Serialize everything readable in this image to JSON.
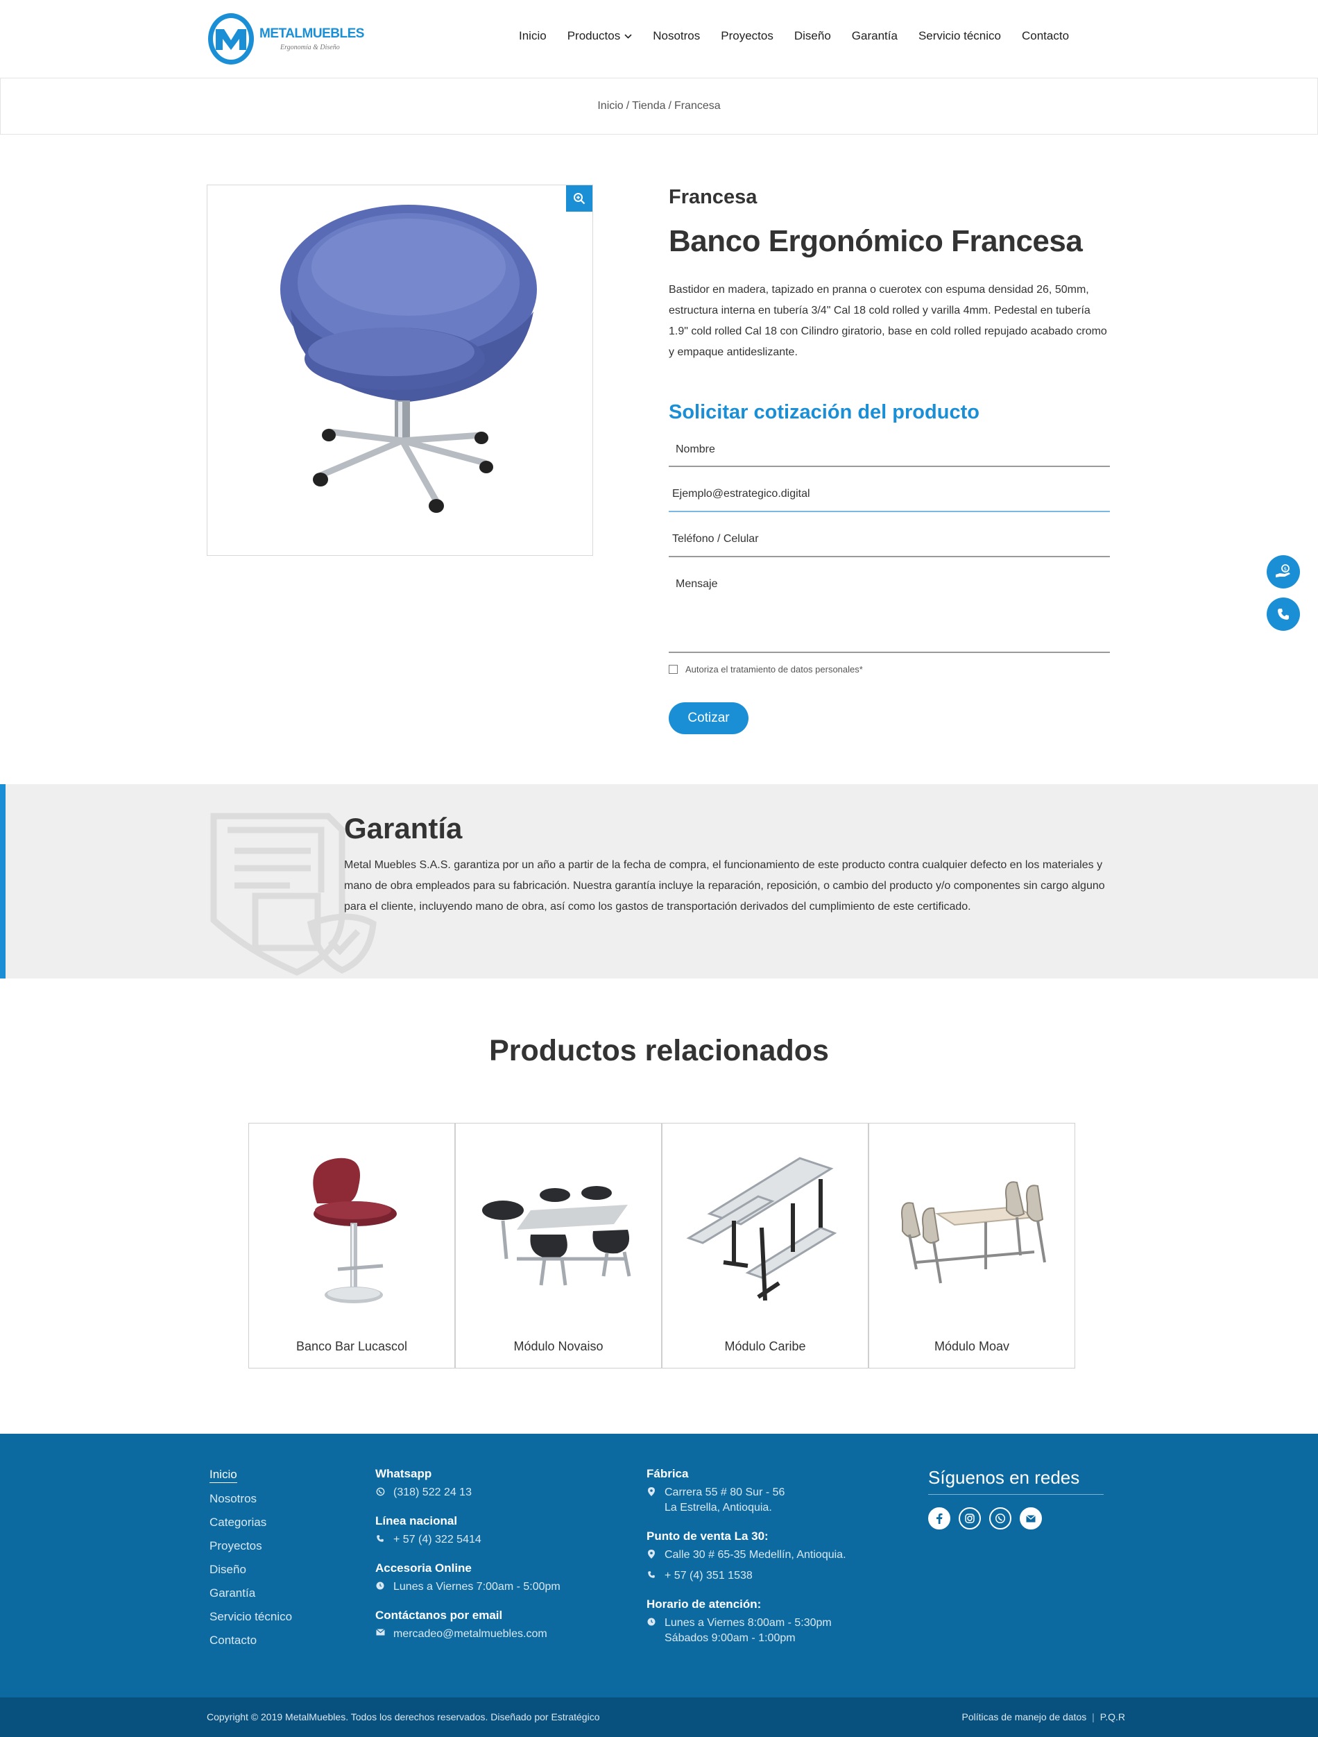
{
  "header": {
    "logo": {
      "name": "METALMUEBLES",
      "tagline": "Ergonomía & Diseño"
    },
    "nav": [
      "Inicio",
      "Productos",
      "Nosotros",
      "Proyectos",
      "Diseño",
      "Garantía",
      "Servicio técnico",
      "Contacto"
    ]
  },
  "breadcrumb": {
    "home": "Inicio",
    "sep": "/",
    "shop": "Tienda",
    "current": "Francesa"
  },
  "product": {
    "category": "Francesa",
    "title": "Banco Ergonómico Francesa",
    "description": "Bastidor en madera, tapizado en pranna o cuerotex con espuma densidad 26, 50mm, estructura interna en tubería 3/4\" Cal 18 cold rolled y varilla 4mm. Pedestal en tubería 1.9\" cold rolled Cal 18 con Cilindro giratorio, base en cold rolled repujado acabado cromo y empaque antideslizante.",
    "image_alt": "Silla Francesa azul"
  },
  "quote_form": {
    "title": "Solicitar cotización del producto",
    "name_placeholder": "Nombre",
    "email_value": "Ejemplo@estrategico.digital",
    "phone_placeholder": "Teléfono / Celular",
    "message_placeholder": "Mensaje",
    "consent_label": "Autoriza el tratamiento de datos personales*",
    "submit_label": "Cotizar"
  },
  "warranty": {
    "title": "Garantía",
    "text": "Metal Muebles S.A.S. garantiza por un año a partir de la fecha de compra, el funcionamiento de este producto contra cualquier defecto en los materiales y mano de obra empleados para su fabricación. Nuestra garantía incluye la reparación, reposición, o cambio del producto y/o componentes sin cargo alguno para el cliente, incluyendo mano de obra, así como los gastos de transportación derivados del cumplimiento de este certificado."
  },
  "related": {
    "title": "Productos relacionados",
    "items": [
      "Banco Bar Lucascol",
      "Módulo Novaiso",
      "Módulo Caribe",
      "Módulo Moav"
    ]
  },
  "footer": {
    "links": [
      "Inicio",
      "Nosotros",
      "Categorias",
      "Proyectos",
      "Diseño",
      "Garantía",
      "Servicio técnico",
      "Contacto"
    ],
    "whatsapp": {
      "title": "Whatsapp",
      "value": "(318) 522 24 13"
    },
    "national": {
      "title": "Línea nacional",
      "value": "+ 57 (4) 322 5414"
    },
    "online": {
      "title": "Accesoria Online",
      "value": "Lunes a Viernes 7:00am - 5:00pm"
    },
    "email": {
      "title": "Contáctanos por email",
      "value": "mercadeo@metalmuebles.com"
    },
    "factory": {
      "title": "Fábrica",
      "line1": "Carrera 55 # 80 Sur - 56",
      "line2": "La Estrella, Antioquia."
    },
    "store": {
      "title": "Punto de venta La 30:",
      "address": "Calle 30 # 65-35 Medellín, Antioquia.",
      "phone": "+ 57 (4) 351 1538"
    },
    "hours": {
      "title": "Horario de atención:",
      "line1": "Lunes a Viernes 8:00am - 5:30pm",
      "line2": "Sábados 9:00am - 1:00pm"
    },
    "follow": {
      "title": "Síguenos en redes",
      "icons": [
        "facebook-icon",
        "instagram-icon",
        "whatsapp-icon",
        "email-icon"
      ]
    },
    "copyright": "Copyright © 2019 MetalMuebles. Todos los derechos reservados. Diseñado por Estratégico",
    "policy": "Políticas de manejo de datos",
    "pqr": "P.Q.R",
    "sep": "|"
  },
  "colors": {
    "accent": "#1a8fd6",
    "footer": "#0d6aa0",
    "footer_bottom": "#08507d",
    "warranty_bg": "#efefef"
  }
}
